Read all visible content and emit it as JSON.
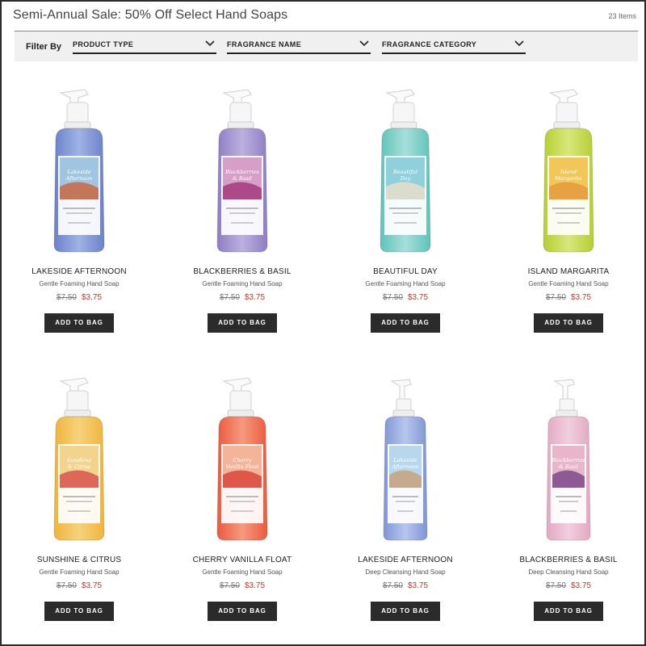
{
  "page": {
    "title": "Semi-Annual Sale: 50% Off Select Hand Soaps",
    "item_count": "23 Items"
  },
  "filters": {
    "label": "Filter By",
    "dropdowns": [
      {
        "label": "PRODUCT TYPE",
        "icon": "chevron-down-icon"
      },
      {
        "label": "FRAGRANCE NAME",
        "icon": "chevron-down-icon"
      },
      {
        "label": "FRAGRANCE CATEGORY",
        "icon": "chevron-down-icon"
      }
    ]
  },
  "products": [
    {
      "name": "LAKESIDE AFTERNOON",
      "type": "Gentle Foaming Hand Soap",
      "old_price": "$7.50",
      "price": "$3.75",
      "button": "ADD TO BAG",
      "label_text": "Lakeside Afternoon",
      "liquid": "#6b82c9",
      "liquid2": "#9fb3e6",
      "sky": "#9fc5e0",
      "scene": "#c9673f"
    },
    {
      "name": "BLACKBERRIES & BASIL",
      "type": "Gentle Foaming Hand Soap",
      "old_price": "$7.50",
      "price": "$3.75",
      "button": "ADD TO BAG",
      "label_text": "Blackberries & Basil",
      "liquid": "#8e7ec2",
      "liquid2": "#bcb0e0",
      "sky": "#d59fc7",
      "scene": "#a63a7c"
    },
    {
      "name": "BEAUTIFUL DAY",
      "type": "Gentle Foaming Hand Soap",
      "old_price": "$7.50",
      "price": "$3.75",
      "button": "ADD TO BAG",
      "label_text": "Beautiful Day",
      "liquid": "#5fc3b9",
      "liquid2": "#a6e0da",
      "sky": "#8fd0dc",
      "scene": "#e8dfc8"
    },
    {
      "name": "ISLAND MARGARITA",
      "type": "Gentle Foaming Hand Soap",
      "old_price": "$7.50",
      "price": "$3.75",
      "button": "ADD TO BAG",
      "label_text": "Island Margarita",
      "liquid": "#b6cf32",
      "liquid2": "#d8e77a",
      "sky": "#f2c75a",
      "scene": "#e59a3c"
    },
    {
      "name": "SUNSHINE & CITRUS",
      "type": "Gentle Foaming Hand Soap",
      "old_price": "$7.50",
      "price": "$3.75",
      "button": "ADD TO BAG",
      "label_text": "Sunshine & Citrus",
      "liquid": "#f0b43a",
      "liquid2": "#f6d27c",
      "sky": "#f2d48e",
      "scene": "#d9534f"
    },
    {
      "name": "CHERRY VANILLA FLOAT",
      "type": "Gentle Foaming Hand Soap",
      "old_price": "$7.50",
      "price": "$3.75",
      "button": "ADD TO BAG",
      "label_text": "Cherry Vanilla Float",
      "liquid": "#ec5a3e",
      "liquid2": "#f49a7f",
      "sky": "#f3b49a",
      "scene": "#d9473a"
    },
    {
      "name": "LAKESIDE AFTERNOON",
      "type": "Deep Cleansing Hand Soap",
      "old_price": "$7.50",
      "price": "$3.75",
      "button": "ADD TO BAG",
      "label_text": "Lakeside Afternoon",
      "liquid": "#7f96d6",
      "liquid2": "#b7c6ec",
      "sky": "#b7d7ec",
      "scene": "#c9a27b"
    },
    {
      "name": "BLACKBERRIES & BASIL",
      "type": "Deep Cleansing Hand Soap",
      "old_price": "$7.50",
      "price": "$3.75",
      "button": "ADD TO BAG",
      "label_text": "Blackberries & Basil",
      "liquid": "#e3a9c2",
      "liquid2": "#f1cfdd",
      "sky": "#e9b5c9",
      "scene": "#7e4a8c"
    }
  ]
}
